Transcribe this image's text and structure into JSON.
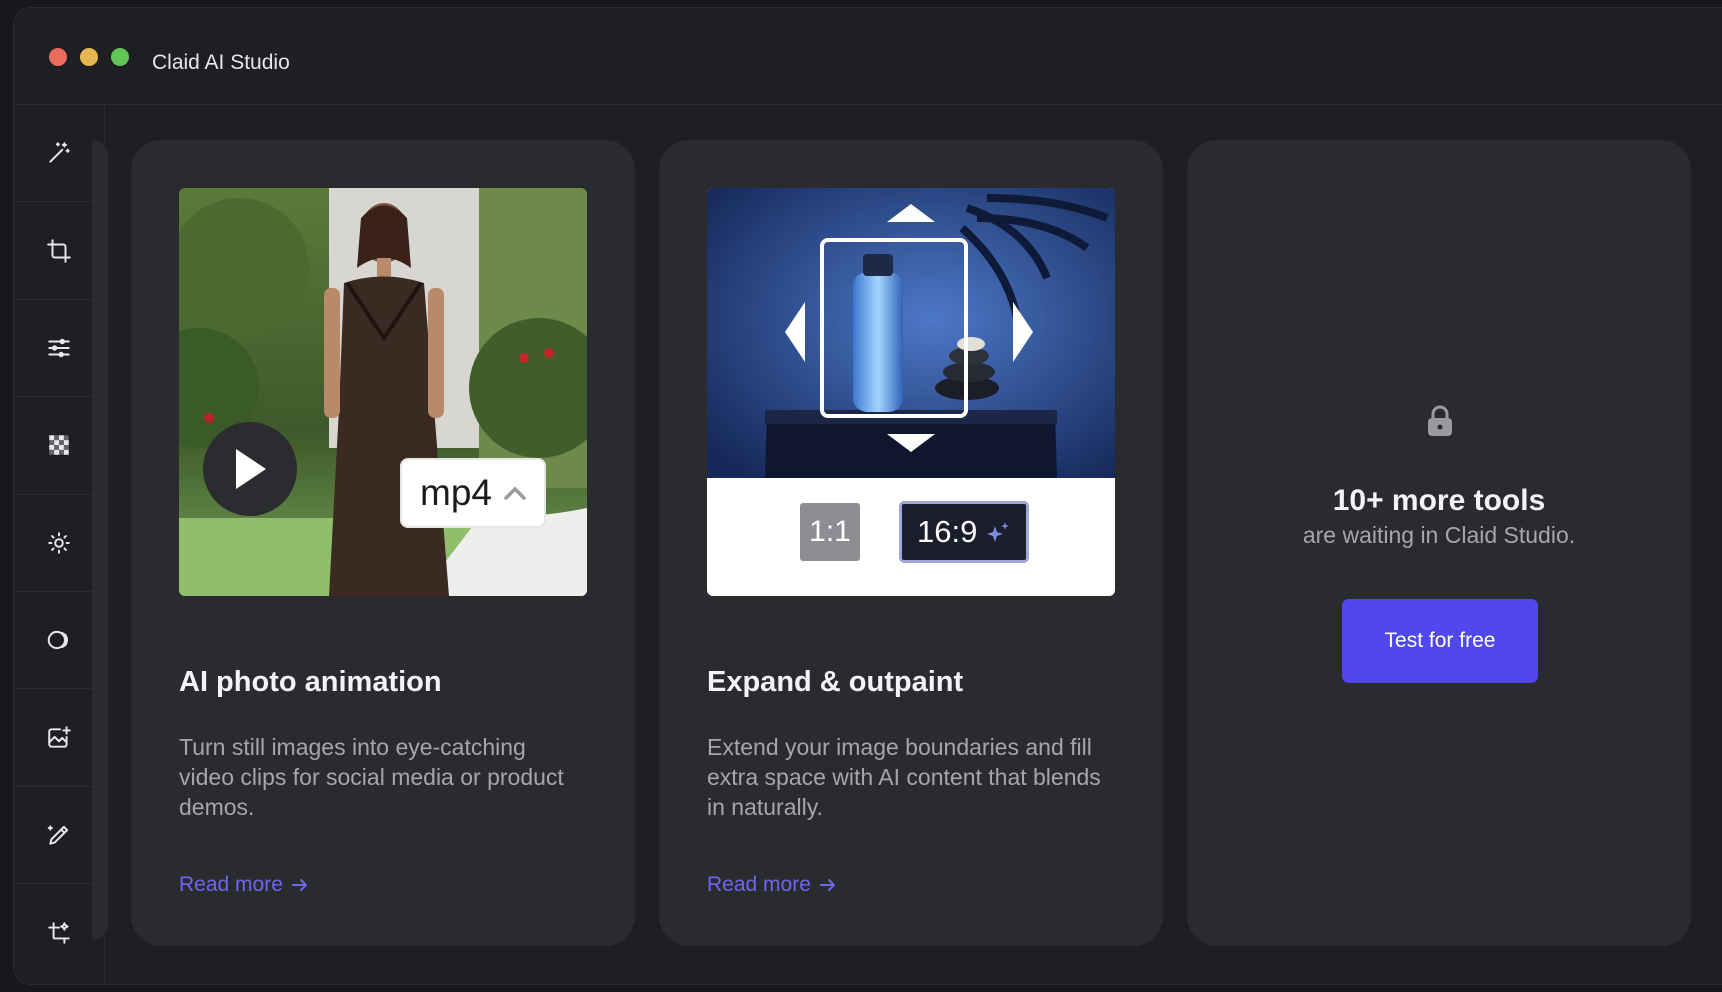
{
  "window": {
    "title": "Claid AI Studio"
  },
  "sidebar": {
    "tools": [
      {
        "icon": "magic-wand-icon"
      },
      {
        "icon": "crop-icon"
      },
      {
        "icon": "adjust-sliders-icon"
      },
      {
        "icon": "transparent-background-icon"
      },
      {
        "icon": "brightness-icon"
      },
      {
        "icon": "shadow-circle-icon"
      },
      {
        "icon": "add-image-icon"
      },
      {
        "icon": "edit-pencil-icon"
      },
      {
        "icon": "crop-sparkle-icon"
      }
    ]
  },
  "cards": [
    {
      "title": "AI photo animation",
      "description": "Turn still images into eye-catching video clips for social media or product demos.",
      "link": "Read more",
      "badge": "mp4"
    },
    {
      "title": "Expand & outpaint",
      "description": "Extend your image boundaries and fill extra space with AI content that blends in naturally.",
      "link": "Read more",
      "ratio_a": "1:1",
      "ratio_b": "16:9"
    }
  ],
  "promo": {
    "title": "10+ more tools",
    "subtitle": "are waiting in Claid Studio.",
    "button": "Test for free"
  },
  "colors": {
    "accent": "#5048ee",
    "link": "#6f66f0",
    "card": "#2a2b2f",
    "background": "#1e1f23"
  }
}
